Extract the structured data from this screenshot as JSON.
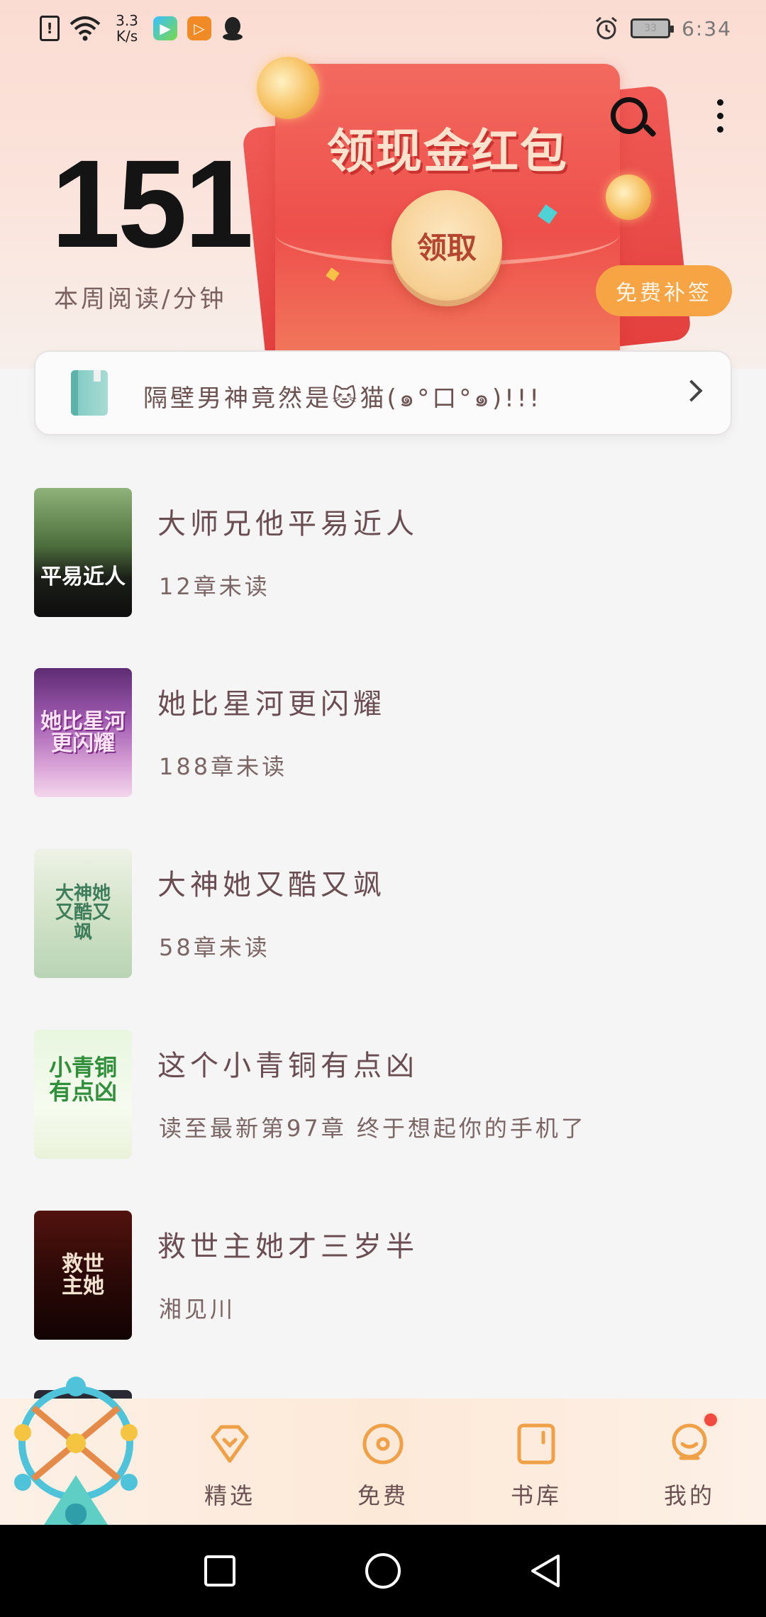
{
  "status_bar": {
    "network_speed": "3.3\nK/s",
    "time": "6:34",
    "battery": "33"
  },
  "reading": {
    "minutes": "151",
    "label": "本周阅读/分钟"
  },
  "banner": {
    "title": "领现金红包",
    "button": "领取"
  },
  "sign_button": "免费补签",
  "notice": {
    "text": "隔壁男神竟然是🐱猫(๑°口°๑)!!!"
  },
  "books": [
    {
      "title": "大师兄他平易近人",
      "subtitle": "12章未读",
      "cover_text": "平易近人"
    },
    {
      "title": "她比星河更闪耀",
      "subtitle": "188章未读",
      "cover_text": "她比星河更闪耀"
    },
    {
      "title": "大神她又酷又飒",
      "subtitle": "58章未读",
      "cover_text": "大神她又酷又飒"
    },
    {
      "title": "这个小青铜有点凶",
      "subtitle": "读至最新第97章 终于想起你的手机了",
      "cover_text": "小青铜有点凶"
    },
    {
      "title": "救世主她才三岁半",
      "subtitle": "湘见川",
      "cover_text": "救世主她"
    }
  ],
  "bottom_nav": [
    {
      "label": "精选"
    },
    {
      "label": "免费"
    },
    {
      "label": "书库"
    },
    {
      "label": "我的"
    }
  ],
  "colors": {
    "accent_orange": "#f7a445",
    "envelope_red": "#ee4f4b",
    "nav_icon": "#f0a046"
  }
}
